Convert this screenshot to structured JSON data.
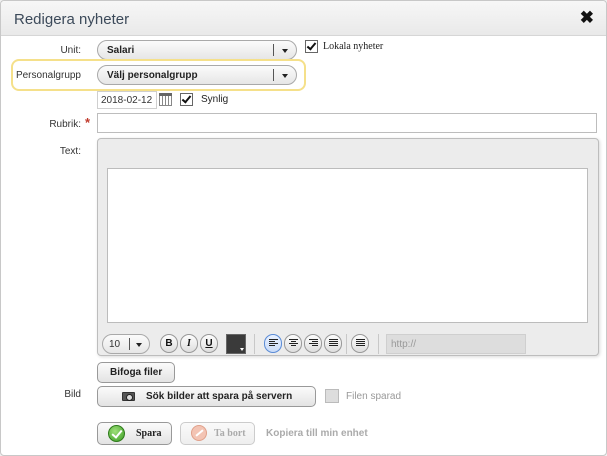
{
  "dialog": {
    "title": "Redigera nyheter",
    "close_glyph": "✖"
  },
  "form": {
    "unit": {
      "label": "Unit:",
      "value": "Salari"
    },
    "local_news": {
      "label": "Lokala nyheter",
      "checked": true
    },
    "personalgrupp": {
      "label": "Personalgrupp",
      "value": "Välj personalgrupp"
    },
    "date": {
      "value": "2018-02-12"
    },
    "visible": {
      "label": "Synlig",
      "checked": true
    },
    "rubrik": {
      "label": "Rubrik:",
      "required_mark": "*",
      "value": ""
    },
    "text": {
      "label": "Text:"
    }
  },
  "editor_toolbar": {
    "font_size": "10",
    "bold": "B",
    "italic": "I",
    "underline": "U",
    "text_color": "#3a3a3a",
    "url_placeholder": "http://"
  },
  "attachments": {
    "attach_button": "Bifoga filer"
  },
  "image": {
    "label": "Bild",
    "search_button": "Sök bilder att spara på servern",
    "saved_label": "Filen sparad"
  },
  "actions": {
    "save": "Spara",
    "delete": "Ta bort",
    "copy_link": "Kopiera till min enhet"
  }
}
